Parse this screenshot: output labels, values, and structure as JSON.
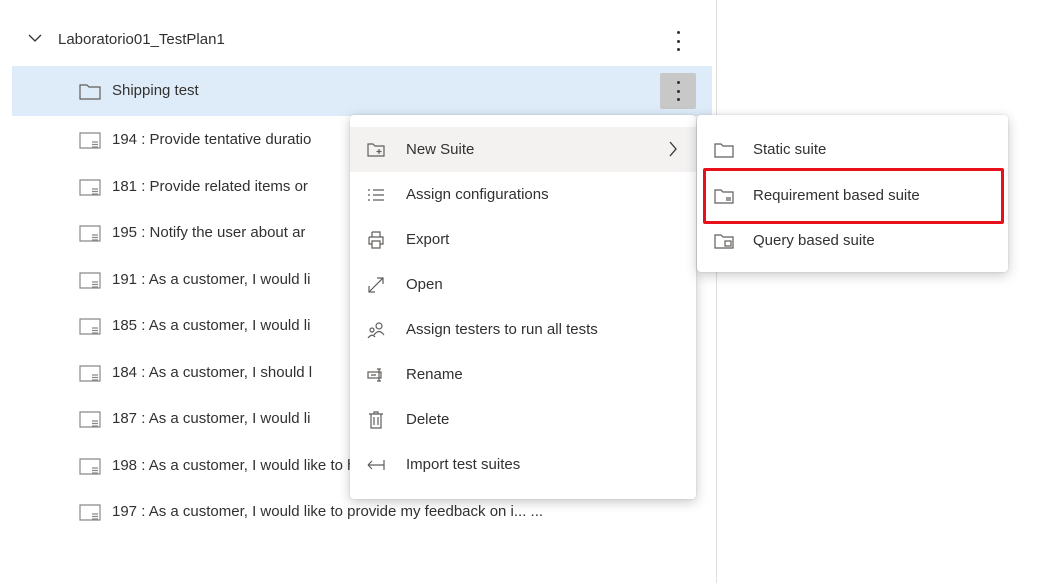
{
  "tree": {
    "root": {
      "label": "Laboratorio01_TestPlan1"
    },
    "selected": {
      "label": "Shipping test"
    },
    "items": [
      {
        "label": "194 : Provide tentative duratio"
      },
      {
        "label": "181 : Provide related items or"
      },
      {
        "label": "195 : Notify the user about ar"
      },
      {
        "label": "191 : As a customer, I would li"
      },
      {
        "label": "185 : As a customer, I would li"
      },
      {
        "label": "184 : As a customer, I should l"
      },
      {
        "label": "187 : As a customer, I would li"
      },
      {
        "label": "198 : As a customer, I would like to have a wishlist where I ca...  ..."
      },
      {
        "label": "197 : As a customer, I would like to provide my feedback on i...  ..."
      }
    ]
  },
  "context_menu": {
    "items": [
      {
        "label": "New Suite",
        "icon": "new-suite-icon"
      },
      {
        "label": "Assign configurations",
        "icon": "list-icon"
      },
      {
        "label": "Export",
        "icon": "printer-icon"
      },
      {
        "label": "Open",
        "icon": "open-icon"
      },
      {
        "label": "Assign testers to run all tests",
        "icon": "people-icon"
      },
      {
        "label": "Rename",
        "icon": "rename-icon"
      },
      {
        "label": "Delete",
        "icon": "trash-icon"
      },
      {
        "label": "Import test suites",
        "icon": "import-icon"
      }
    ]
  },
  "submenu": {
    "items": [
      {
        "label": "Static suite",
        "icon": "folder-icon"
      },
      {
        "label": "Requirement based suite",
        "icon": "requirement-suite-icon"
      },
      {
        "label": "Query based suite",
        "icon": "query-suite-icon"
      }
    ]
  },
  "colors": {
    "selected_row": "#deecf9",
    "highlight": "#e8101a",
    "text": "#323130"
  }
}
